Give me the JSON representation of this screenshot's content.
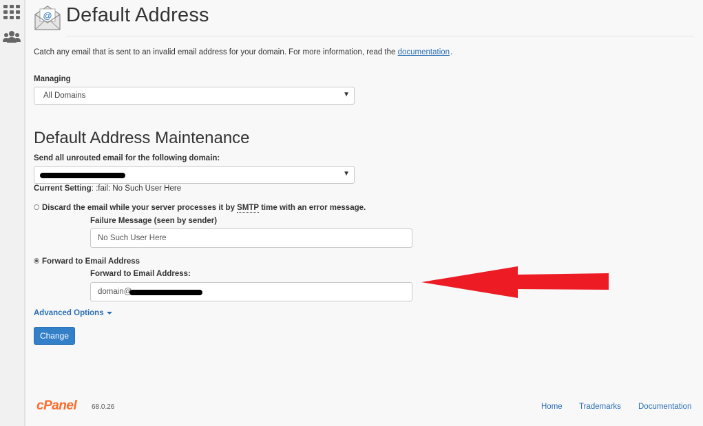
{
  "page": {
    "title": "Default Address",
    "intro_text": "Catch any email that is sent to an invalid email address for your domain. For more information, read the ",
    "intro_link": "documentation",
    "intro_trail": "."
  },
  "managing": {
    "label": "Managing",
    "selected": "All Domains"
  },
  "maintenance": {
    "title": "Default Address Maintenance",
    "domain_label": "Send all unrouted email for the following domain:",
    "current_setting_label": "Current Setting",
    "current_setting_value": ": :fail: No Such User Here",
    "discard": {
      "label_start": "Discard the email while your server processes it by ",
      "label_abbr": "SMTP",
      "label_end": " time with an error message.",
      "checked": false,
      "failure_label": "Failure Message (seen by sender)",
      "failure_value": "No Such User Here"
    },
    "forward": {
      "label": "Forward to Email Address",
      "checked": true,
      "field_label": "Forward to Email Address:",
      "field_value_visible": "domain@"
    },
    "advanced_label": "Advanced Options",
    "change_button": "Change"
  },
  "footer": {
    "logo": "cPanel",
    "version": "68.0.26",
    "links": [
      "Home",
      "Trademarks",
      "Documentation"
    ]
  },
  "colors": {
    "link": "#2a6eb5",
    "button": "#3380c9",
    "arrow": "#ed1c24",
    "logo": "#ff6c2c"
  }
}
